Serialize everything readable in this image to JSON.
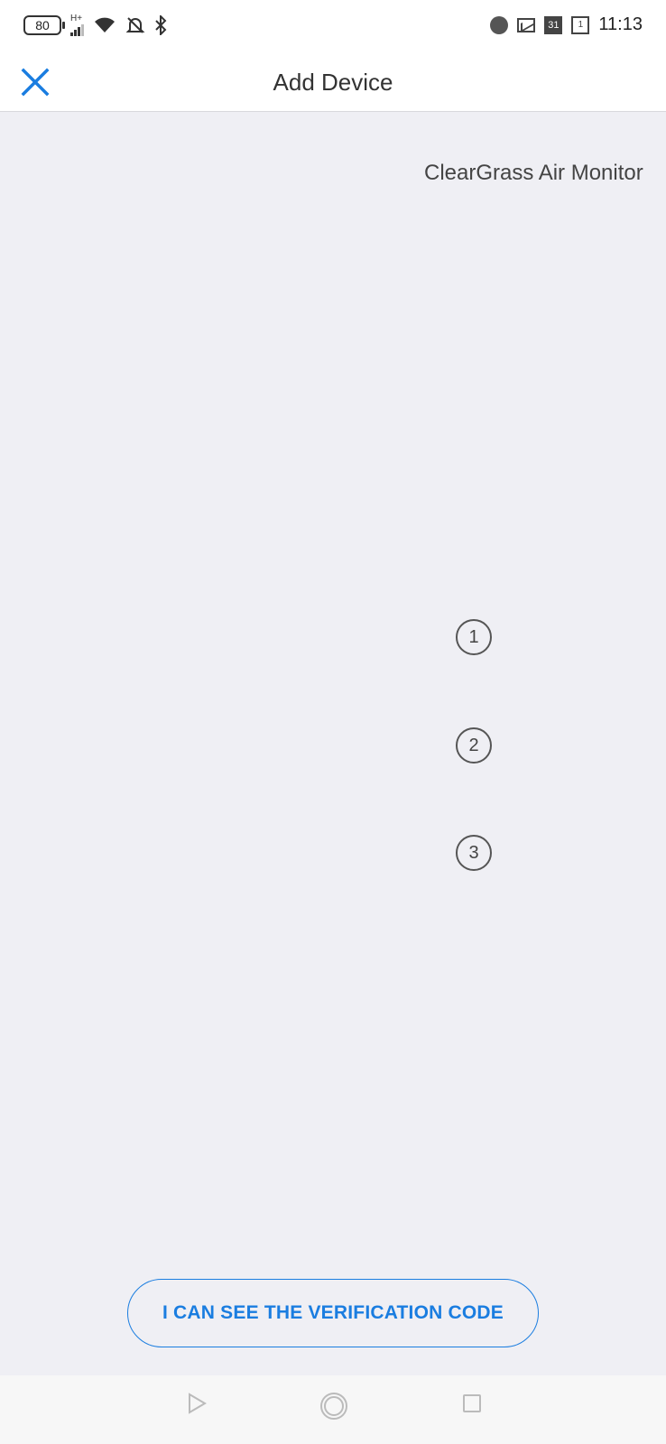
{
  "status_bar": {
    "battery": "80",
    "network": "H+",
    "time": "11:13",
    "calendar_day": "31",
    "calendar_small": "1",
    "icons_left": [
      "battery-icon",
      "signal-icon",
      "wifi-icon",
      "alarm-off-icon",
      "bluetooth-icon"
    ],
    "icons_right": [
      "chrome-icon",
      "gmail-icon",
      "calendar-icon",
      "calendar-outline-icon"
    ]
  },
  "header": {
    "title": "Add Device",
    "close_icon": "close-icon",
    "accent_color": "#1a7de0"
  },
  "content": {
    "device_name": "ClearGrass Air Monitor",
    "steps": [
      "1",
      "2",
      "3"
    ]
  },
  "footer": {
    "verify_button_label": "I CAN SEE THE VERIFICATION CODE"
  },
  "nav": {
    "icons": [
      "back-icon",
      "home-icon",
      "recent-apps-icon"
    ]
  }
}
